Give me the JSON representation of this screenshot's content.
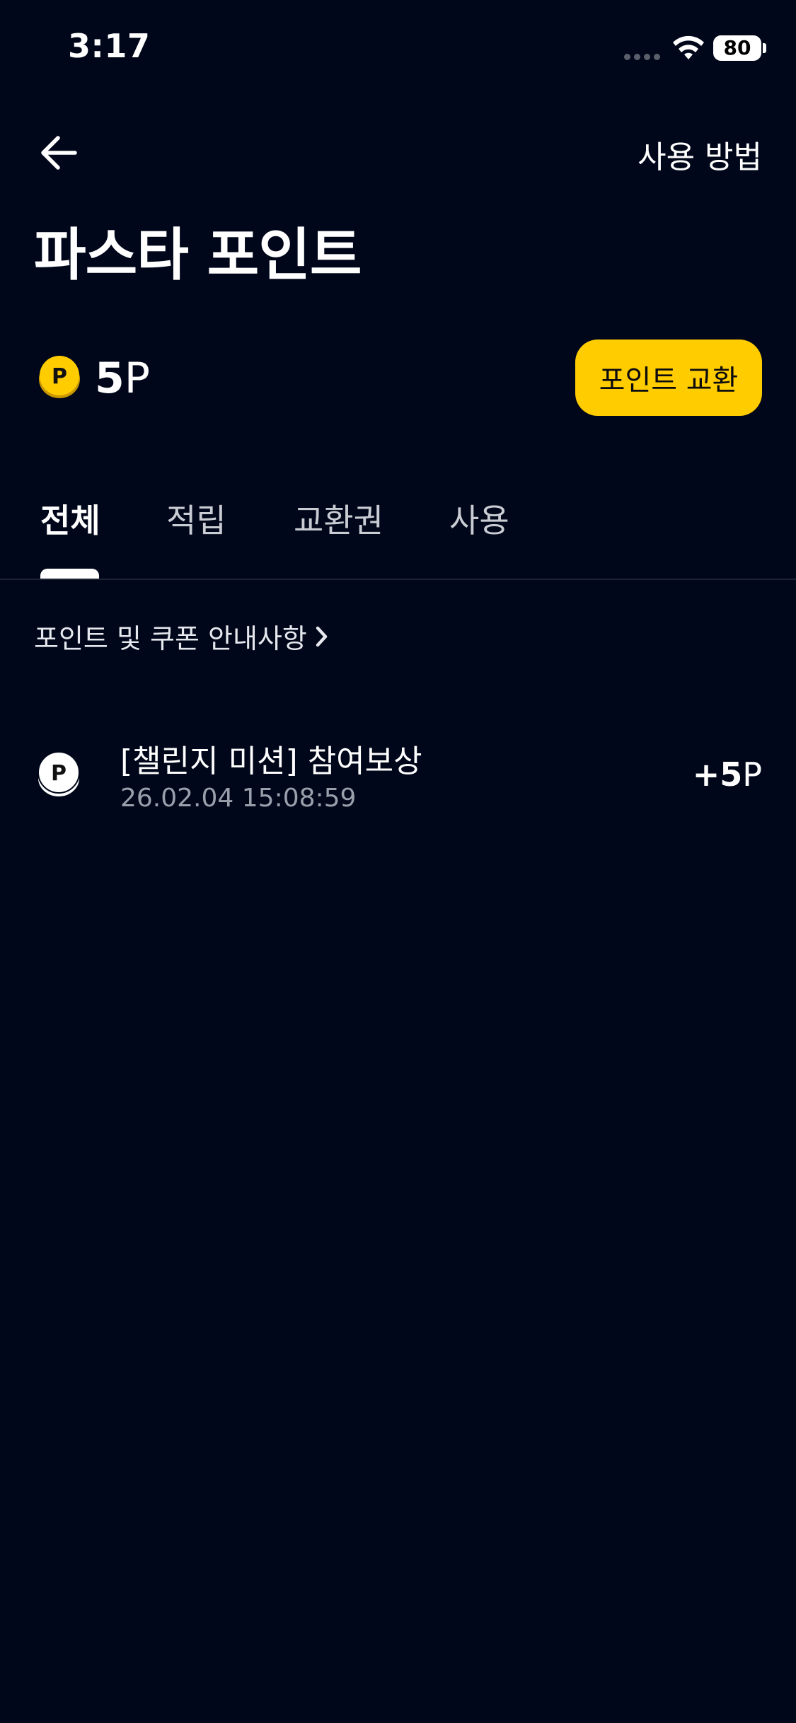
{
  "status_bar": {
    "time": "3:17",
    "battery": "80"
  },
  "nav": {
    "help_label": "사용 방법"
  },
  "page": {
    "title": "파스타 포인트"
  },
  "balance": {
    "amount": "5",
    "unit": "P",
    "exchange_label": "포인트 교환"
  },
  "tabs": [
    {
      "label": "전체",
      "active": true
    },
    {
      "label": "적립",
      "active": false
    },
    {
      "label": "교환권",
      "active": false
    },
    {
      "label": "사용",
      "active": false
    }
  ],
  "notice": {
    "label": "포인트 및 쿠폰 안내사항"
  },
  "history": [
    {
      "title": "[챌린지 미션] 참여보상",
      "date": "26.02.04 15:08:59",
      "amount_sign_value": "+5",
      "amount_unit": "P"
    }
  ],
  "colors": {
    "background": "#01071a",
    "accent": "#ffcc00",
    "secondary_text": "#9aa0ab"
  }
}
